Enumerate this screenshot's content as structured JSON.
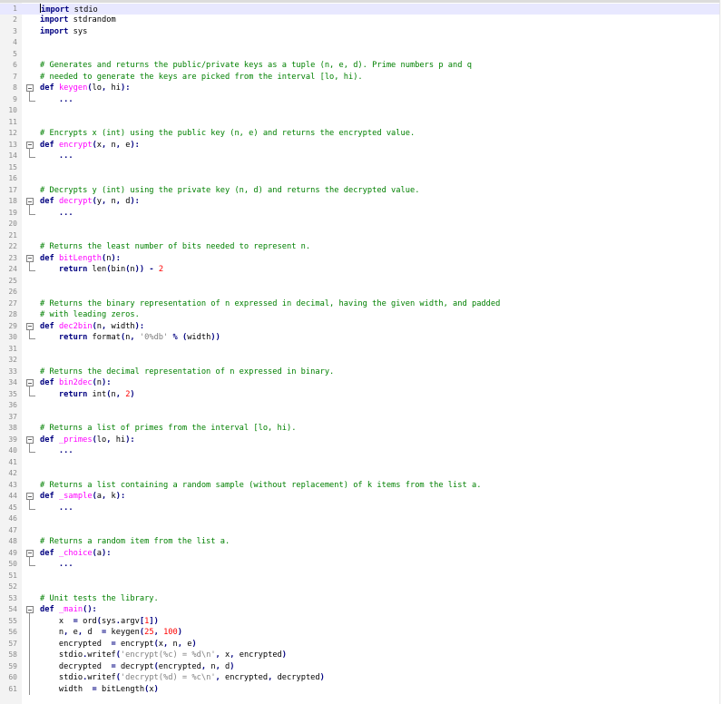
{
  "editor": {
    "current_line": 1,
    "lines": [
      {
        "n": "1",
        "fold": "",
        "t": [
          [
            "kw",
            "import"
          ],
          [
            "",
            "stdio"
          ]
        ]
      },
      {
        "n": "2",
        "fold": "",
        "t": [
          [
            "kw",
            "import"
          ],
          [
            "",
            "stdrandom"
          ]
        ]
      },
      {
        "n": "3",
        "fold": "",
        "t": [
          [
            "kw",
            "import"
          ],
          [
            "",
            "sys"
          ]
        ]
      },
      {
        "n": "4",
        "fold": "",
        "t": []
      },
      {
        "n": "5",
        "fold": "",
        "t": []
      },
      {
        "n": "6",
        "fold": "",
        "t": [
          [
            "cm",
            "# Generates and returns the public/private keys as a tuple (n, e, d). Prime numbers p and q"
          ]
        ]
      },
      {
        "n": "7",
        "fold": "",
        "t": [
          [
            "cm",
            "# needed to generate the keys are picked from the interval [lo, hi)."
          ]
        ]
      },
      {
        "n": "8",
        "fold": "box",
        "t": [
          [
            "kw",
            "def"
          ],
          [
            "fn",
            "keygen"
          ],
          [
            "op",
            "("
          ],
          [
            "",
            "lo"
          ],
          [
            "op",
            ","
          ],
          [
            "",
            "hi"
          ],
          [
            "op",
            "):"
          ]
        ]
      },
      {
        "n": "9",
        "fold": "end",
        "t": [
          [
            "",
            "    "
          ],
          [
            "op",
            "..."
          ]
        ]
      },
      {
        "n": "10",
        "fold": "",
        "t": []
      },
      {
        "n": "11",
        "fold": "",
        "t": []
      },
      {
        "n": "12",
        "fold": "",
        "t": [
          [
            "cm",
            "# Encrypts x (int) using the public key (n, e) and returns the encrypted value."
          ]
        ]
      },
      {
        "n": "13",
        "fold": "box",
        "t": [
          [
            "kw",
            "def"
          ],
          [
            "fn",
            "encrypt"
          ],
          [
            "op",
            "("
          ],
          [
            "",
            "x"
          ],
          [
            "op",
            ","
          ],
          [
            "",
            "n"
          ],
          [
            "op",
            ","
          ],
          [
            "",
            "e"
          ],
          [
            "op",
            "):"
          ]
        ]
      },
      {
        "n": "14",
        "fold": "end",
        "t": [
          [
            "",
            "    "
          ],
          [
            "op",
            "..."
          ]
        ]
      },
      {
        "n": "15",
        "fold": "",
        "t": []
      },
      {
        "n": "16",
        "fold": "",
        "t": []
      },
      {
        "n": "17",
        "fold": "",
        "t": [
          [
            "cm",
            "# Decrypts y (int) using the private key (n, d) and returns the decrypted value."
          ]
        ]
      },
      {
        "n": "18",
        "fold": "box",
        "t": [
          [
            "kw",
            "def"
          ],
          [
            "fn",
            "decrypt"
          ],
          [
            "op",
            "("
          ],
          [
            "",
            "y"
          ],
          [
            "op",
            ","
          ],
          [
            "",
            "n"
          ],
          [
            "op",
            ","
          ],
          [
            "",
            "d"
          ],
          [
            "op",
            "):"
          ]
        ]
      },
      {
        "n": "19",
        "fold": "end",
        "t": [
          [
            "",
            "    "
          ],
          [
            "op",
            "..."
          ]
        ]
      },
      {
        "n": "20",
        "fold": "",
        "t": []
      },
      {
        "n": "21",
        "fold": "",
        "t": []
      },
      {
        "n": "22",
        "fold": "",
        "t": [
          [
            "cm",
            "# Returns the least number of bits needed to represent n."
          ]
        ]
      },
      {
        "n": "23",
        "fold": "box",
        "t": [
          [
            "kw",
            "def"
          ],
          [
            "fn",
            "bitLength"
          ],
          [
            "op",
            "("
          ],
          [
            "",
            "n"
          ],
          [
            "op",
            "):"
          ]
        ]
      },
      {
        "n": "24",
        "fold": "end",
        "t": [
          [
            "",
            "    "
          ],
          [
            "kw",
            "return"
          ],
          [
            "",
            "len"
          ],
          [
            "op",
            "("
          ],
          [
            "",
            "bin"
          ],
          [
            "op",
            "("
          ],
          [
            "",
            "n"
          ],
          [
            "op",
            "))"
          ],
          [
            "op",
            "-"
          ],
          [
            "nm",
            "2"
          ]
        ]
      },
      {
        "n": "25",
        "fold": "",
        "t": []
      },
      {
        "n": "26",
        "fold": "",
        "t": []
      },
      {
        "n": "27",
        "fold": "",
        "t": [
          [
            "cm",
            "# Returns the binary representation of n expressed in decimal, having the given width, and padded"
          ]
        ]
      },
      {
        "n": "28",
        "fold": "",
        "t": [
          [
            "cm",
            "# with leading zeros."
          ]
        ]
      },
      {
        "n": "29",
        "fold": "box",
        "t": [
          [
            "kw",
            "def"
          ],
          [
            "fn",
            "dec2bin"
          ],
          [
            "op",
            "("
          ],
          [
            "",
            "n"
          ],
          [
            "op",
            ","
          ],
          [
            "",
            "width"
          ],
          [
            "op",
            "):"
          ]
        ]
      },
      {
        "n": "30",
        "fold": "end",
        "t": [
          [
            "",
            "    "
          ],
          [
            "kw",
            "return"
          ],
          [
            "",
            "format"
          ],
          [
            "op",
            "("
          ],
          [
            "",
            "n"
          ],
          [
            "op",
            ","
          ],
          [
            "st",
            "'0%db'"
          ],
          [
            "op",
            "%"
          ],
          [
            "op",
            "("
          ],
          [
            "",
            "width"
          ],
          [
            "op",
            "))"
          ]
        ]
      },
      {
        "n": "31",
        "fold": "",
        "t": []
      },
      {
        "n": "32",
        "fold": "",
        "t": []
      },
      {
        "n": "33",
        "fold": "",
        "t": [
          [
            "cm",
            "# Returns the decimal representation of n expressed in binary."
          ]
        ]
      },
      {
        "n": "34",
        "fold": "box",
        "t": [
          [
            "kw",
            "def"
          ],
          [
            "fn",
            "bin2dec"
          ],
          [
            "op",
            "("
          ],
          [
            "",
            "n"
          ],
          [
            "op",
            "):"
          ]
        ]
      },
      {
        "n": "35",
        "fold": "end",
        "t": [
          [
            "",
            "    "
          ],
          [
            "kw",
            "return"
          ],
          [
            "",
            "int"
          ],
          [
            "op",
            "("
          ],
          [
            "",
            "n"
          ],
          [
            "op",
            ","
          ],
          [
            "nm",
            "2"
          ],
          [
            "op",
            ")"
          ]
        ]
      },
      {
        "n": "36",
        "fold": "",
        "t": []
      },
      {
        "n": "37",
        "fold": "",
        "t": []
      },
      {
        "n": "38",
        "fold": "",
        "t": [
          [
            "cm",
            "# Returns a list of primes from the interval [lo, hi)."
          ]
        ]
      },
      {
        "n": "39",
        "fold": "box",
        "t": [
          [
            "kw",
            "def"
          ],
          [
            "fn",
            "_primes"
          ],
          [
            "op",
            "("
          ],
          [
            "",
            "lo"
          ],
          [
            "op",
            ","
          ],
          [
            "",
            "hi"
          ],
          [
            "op",
            "):"
          ]
        ]
      },
      {
        "n": "40",
        "fold": "end",
        "t": [
          [
            "",
            "    "
          ],
          [
            "op",
            "..."
          ]
        ]
      },
      {
        "n": "41",
        "fold": "",
        "t": []
      },
      {
        "n": "42",
        "fold": "",
        "t": []
      },
      {
        "n": "43",
        "fold": "",
        "t": [
          [
            "cm",
            "# Returns a list containing a random sample (without replacement) of k items from the list a."
          ]
        ]
      },
      {
        "n": "44",
        "fold": "box",
        "t": [
          [
            "kw",
            "def"
          ],
          [
            "fn",
            "_sample"
          ],
          [
            "op",
            "("
          ],
          [
            "",
            "a"
          ],
          [
            "op",
            ","
          ],
          [
            "",
            "k"
          ],
          [
            "op",
            "):"
          ]
        ]
      },
      {
        "n": "45",
        "fold": "end",
        "t": [
          [
            "",
            "    "
          ],
          [
            "op",
            "..."
          ]
        ]
      },
      {
        "n": "46",
        "fold": "",
        "t": []
      },
      {
        "n": "47",
        "fold": "",
        "t": []
      },
      {
        "n": "48",
        "fold": "",
        "t": [
          [
            "cm",
            "# Returns a random item from the list a."
          ]
        ]
      },
      {
        "n": "49",
        "fold": "box",
        "t": [
          [
            "kw",
            "def"
          ],
          [
            "fn",
            "_choice"
          ],
          [
            "op",
            "("
          ],
          [
            "",
            "a"
          ],
          [
            "op",
            "):"
          ]
        ]
      },
      {
        "n": "50",
        "fold": "end",
        "t": [
          [
            "",
            "    "
          ],
          [
            "op",
            "..."
          ]
        ]
      },
      {
        "n": "51",
        "fold": "",
        "t": []
      },
      {
        "n": "52",
        "fold": "",
        "t": []
      },
      {
        "n": "53",
        "fold": "",
        "t": [
          [
            "cm",
            "# Unit tests the library."
          ]
        ]
      },
      {
        "n": "54",
        "fold": "box",
        "t": [
          [
            "kw",
            "def"
          ],
          [
            "fn",
            "_main"
          ],
          [
            "op",
            "():"
          ]
        ]
      },
      {
        "n": "55",
        "fold": "line",
        "t": [
          [
            "",
            "    x "
          ],
          [
            "op",
            "="
          ],
          [
            "",
            "ord"
          ],
          [
            "op",
            "("
          ],
          [
            "",
            "sys"
          ],
          [
            "op",
            "."
          ],
          [
            "",
            "argv"
          ],
          [
            "op",
            "["
          ],
          [
            "nm",
            "1"
          ],
          [
            "op",
            "])"
          ]
        ]
      },
      {
        "n": "56",
        "fold": "line",
        "t": [
          [
            "",
            "    n"
          ],
          [
            "op",
            ","
          ],
          [
            "",
            "e"
          ],
          [
            "op",
            ","
          ],
          [
            "",
            "d "
          ],
          [
            "op",
            "="
          ],
          [
            "",
            "keygen"
          ],
          [
            "op",
            "("
          ],
          [
            "nm",
            "25"
          ],
          [
            "op",
            ","
          ],
          [
            "nm",
            "100"
          ],
          [
            "op",
            ")"
          ]
        ]
      },
      {
        "n": "57",
        "fold": "line",
        "t": [
          [
            "",
            "    encrypted "
          ],
          [
            "op",
            "="
          ],
          [
            "",
            "encrypt"
          ],
          [
            "op",
            "("
          ],
          [
            "",
            "x"
          ],
          [
            "op",
            ","
          ],
          [
            "",
            "n"
          ],
          [
            "op",
            ","
          ],
          [
            "",
            "e"
          ],
          [
            "op",
            ")"
          ]
        ]
      },
      {
        "n": "58",
        "fold": "line",
        "t": [
          [
            "",
            "    stdio"
          ],
          [
            "op",
            "."
          ],
          [
            "",
            "writef"
          ],
          [
            "op",
            "("
          ],
          [
            "st",
            "'encrypt(%c) = %d\\n'"
          ],
          [
            "op",
            ","
          ],
          [
            "",
            "x"
          ],
          [
            "op",
            ","
          ],
          [
            "",
            "encrypted"
          ],
          [
            "op",
            ")"
          ]
        ]
      },
      {
        "n": "59",
        "fold": "line",
        "t": [
          [
            "",
            "    decrypted "
          ],
          [
            "op",
            "="
          ],
          [
            "",
            "decrypt"
          ],
          [
            "op",
            "("
          ],
          [
            "",
            "encrypted"
          ],
          [
            "op",
            ","
          ],
          [
            "",
            "n"
          ],
          [
            "op",
            ","
          ],
          [
            "",
            "d"
          ],
          [
            "op",
            ")"
          ]
        ]
      },
      {
        "n": "60",
        "fold": "line",
        "t": [
          [
            "",
            "    stdio"
          ],
          [
            "op",
            "."
          ],
          [
            "",
            "writef"
          ],
          [
            "op",
            "("
          ],
          [
            "st",
            "'decrypt(%d) = %c\\n'"
          ],
          [
            "op",
            ","
          ],
          [
            "",
            "encrypted"
          ],
          [
            "op",
            ","
          ],
          [
            "",
            "decrypted"
          ],
          [
            "op",
            ")"
          ]
        ]
      },
      {
        "n": "61",
        "fold": "line",
        "t": [
          [
            "",
            "    width "
          ],
          [
            "op",
            "="
          ],
          [
            "",
            "bitLength"
          ],
          [
            "op",
            "("
          ],
          [
            "",
            "x"
          ],
          [
            "op",
            ")"
          ]
        ]
      }
    ]
  }
}
